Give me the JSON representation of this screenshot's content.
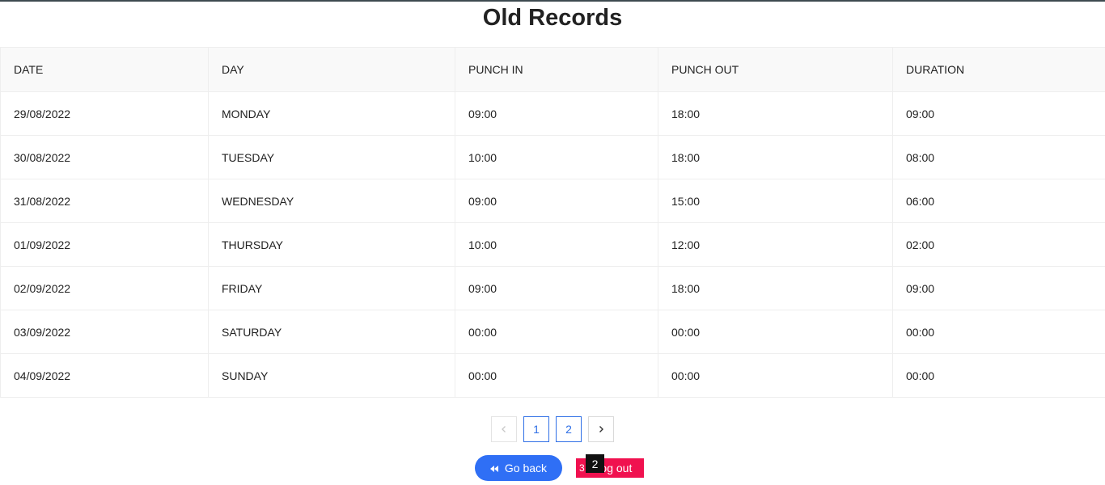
{
  "page": {
    "title": "Old Records"
  },
  "table": {
    "headers": [
      "DATE",
      "DAY",
      "PUNCH IN",
      "PUNCH OUT",
      "DURATION"
    ],
    "rows": [
      [
        "29/08/2022",
        "MONDAY",
        "09:00",
        "18:00",
        "09:00"
      ],
      [
        "30/08/2022",
        "TUESDAY",
        "10:00",
        "18:00",
        "08:00"
      ],
      [
        "31/08/2022",
        "WEDNESDAY",
        "09:00",
        "15:00",
        "06:00"
      ],
      [
        "01/09/2022",
        "THURSDAY",
        "10:00",
        "12:00",
        "02:00"
      ],
      [
        "02/09/2022",
        "FRIDAY",
        "09:00",
        "18:00",
        "09:00"
      ],
      [
        "03/09/2022",
        "SATURDAY",
        "00:00",
        "00:00",
        "00:00"
      ],
      [
        "04/09/2022",
        "SUNDAY",
        "00:00",
        "00:00",
        "00:00"
      ]
    ]
  },
  "pagination": {
    "pages": [
      "1",
      "2"
    ],
    "prev_icon": "chevron-left-icon",
    "next_icon": "chevron-right-icon"
  },
  "actions": {
    "go_back_label": "Go back",
    "go_back_icon": "backward-icon",
    "logout_label": "Log out",
    "logout_icon_text": "3"
  },
  "overlay": {
    "badge": "2"
  },
  "colors": {
    "primary": "#2f6ff5",
    "danger": "#f0114f",
    "header_bg": "#f9f9f9",
    "top_border": "#3d4a50"
  }
}
